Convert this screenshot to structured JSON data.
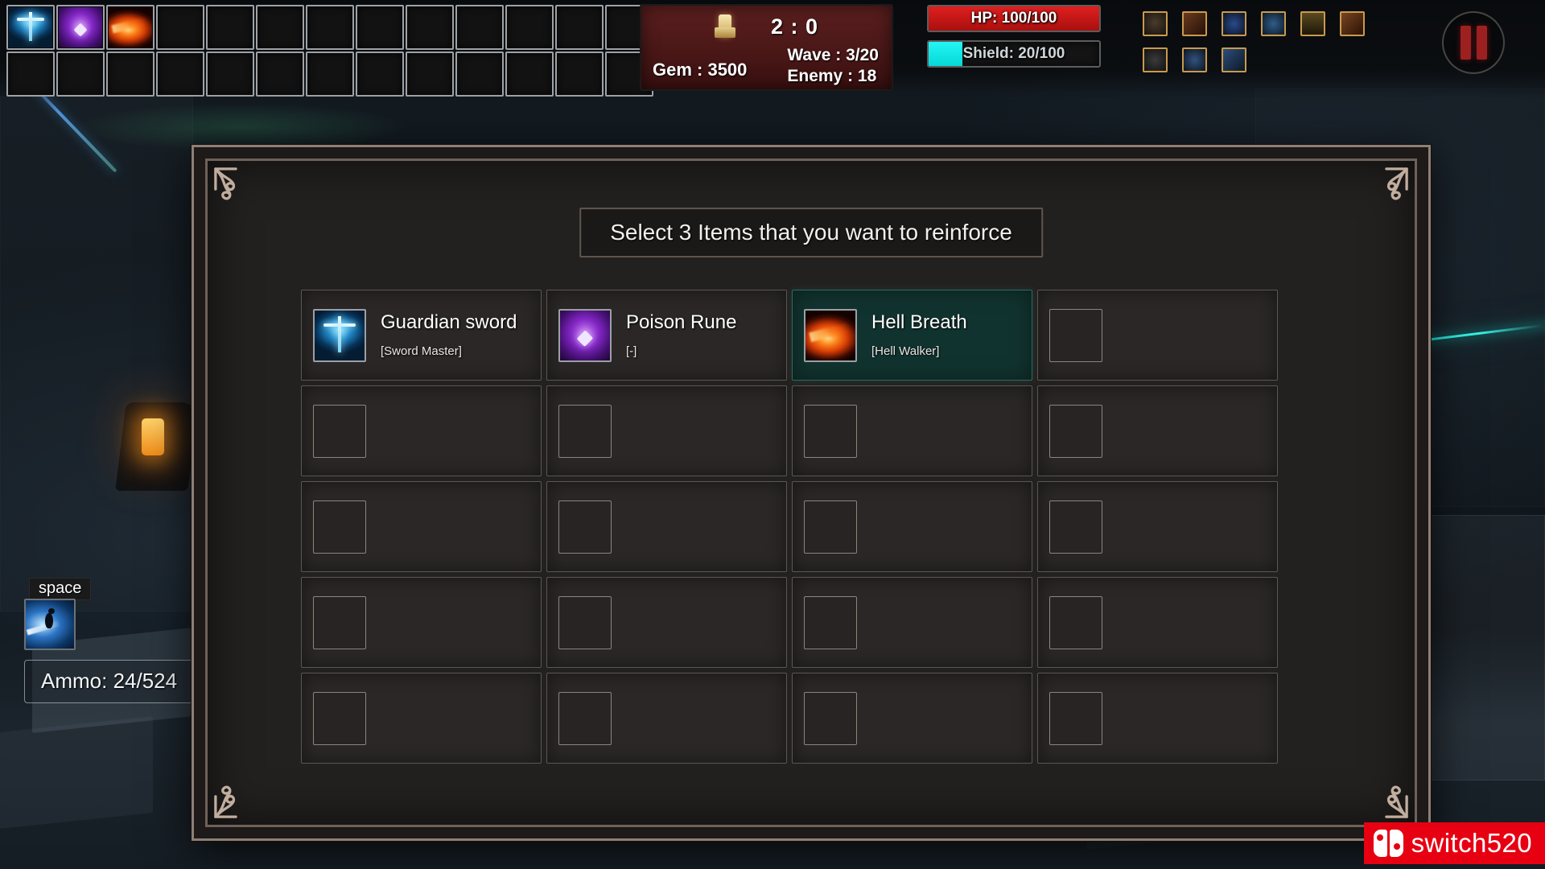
{
  "background": {
    "description": "dark industrial sci-fi facility interior"
  },
  "inventory": {
    "columns": 13,
    "rows": 2,
    "slots": [
      {
        "name": "Guardian sword",
        "art": "art-sword",
        "filled": true
      },
      {
        "name": "Poison Rune",
        "art": "art-rune",
        "filled": true
      },
      {
        "name": "Hell Breath",
        "art": "art-hell",
        "filled": true
      }
    ]
  },
  "stats": {
    "gem_icon": "gem-icon",
    "timer": "2 : 0",
    "gem_label": "Gem : 3500",
    "wave_label": "Wave : 3/20",
    "enemy_label": "Enemy : 18"
  },
  "vitals": {
    "hp": {
      "label": "HP: 100/100",
      "percent": 100,
      "color": "#e01f1f"
    },
    "shield": {
      "label": "Shield: 20/100",
      "percent": 20,
      "color": "#24f4f4"
    }
  },
  "skillbar": {
    "row1": [
      "sk-a",
      "sk-b",
      "sk-c",
      "sk-d",
      "sk-e",
      "sk-f"
    ],
    "row2": [
      "sk-g",
      "sk-h",
      "sk-i"
    ]
  },
  "pause_button": {
    "icon": "pause-icon"
  },
  "ability": {
    "key": "space",
    "icon": "dash-ability-icon",
    "ammo": "Ammo: 24/524"
  },
  "modal": {
    "title": "Select 3 Items that you want to reinforce",
    "columns": 4,
    "rows": 5,
    "items": [
      {
        "name": "Guardian sword",
        "sub": "[Sword Master]",
        "art": "art-sword",
        "filled": true,
        "selected": false
      },
      {
        "name": "Poison Rune",
        "sub": "[-]",
        "art": "art-rune",
        "filled": true,
        "selected": false
      },
      {
        "name": "Hell Breath",
        "sub": "[Hell Walker]",
        "art": "art-hell",
        "filled": true,
        "selected": true
      },
      {
        "name": "",
        "sub": "",
        "art": "",
        "filled": false,
        "selected": false
      },
      {
        "name": "",
        "sub": "",
        "art": "",
        "filled": false,
        "selected": false
      },
      {
        "name": "",
        "sub": "",
        "art": "",
        "filled": false,
        "selected": false
      },
      {
        "name": "",
        "sub": "",
        "art": "",
        "filled": false,
        "selected": false
      },
      {
        "name": "",
        "sub": "",
        "art": "",
        "filled": false,
        "selected": false
      },
      {
        "name": "",
        "sub": "",
        "art": "",
        "filled": false,
        "selected": false
      },
      {
        "name": "",
        "sub": "",
        "art": "",
        "filled": false,
        "selected": false
      },
      {
        "name": "",
        "sub": "",
        "art": "",
        "filled": false,
        "selected": false
      },
      {
        "name": "",
        "sub": "",
        "art": "",
        "filled": false,
        "selected": false
      },
      {
        "name": "",
        "sub": "",
        "art": "",
        "filled": false,
        "selected": false
      },
      {
        "name": "",
        "sub": "",
        "art": "",
        "filled": false,
        "selected": false
      },
      {
        "name": "",
        "sub": "",
        "art": "",
        "filled": false,
        "selected": false
      },
      {
        "name": "",
        "sub": "",
        "art": "",
        "filled": false,
        "selected": false
      },
      {
        "name": "",
        "sub": "",
        "art": "",
        "filled": false,
        "selected": false
      },
      {
        "name": "",
        "sub": "",
        "art": "",
        "filled": false,
        "selected": false
      },
      {
        "name": "",
        "sub": "",
        "art": "",
        "filled": false,
        "selected": false
      },
      {
        "name": "",
        "sub": "",
        "art": "",
        "filled": false,
        "selected": false
      }
    ]
  },
  "watermark": {
    "text": "switch520",
    "brand_color": "#e60012"
  }
}
